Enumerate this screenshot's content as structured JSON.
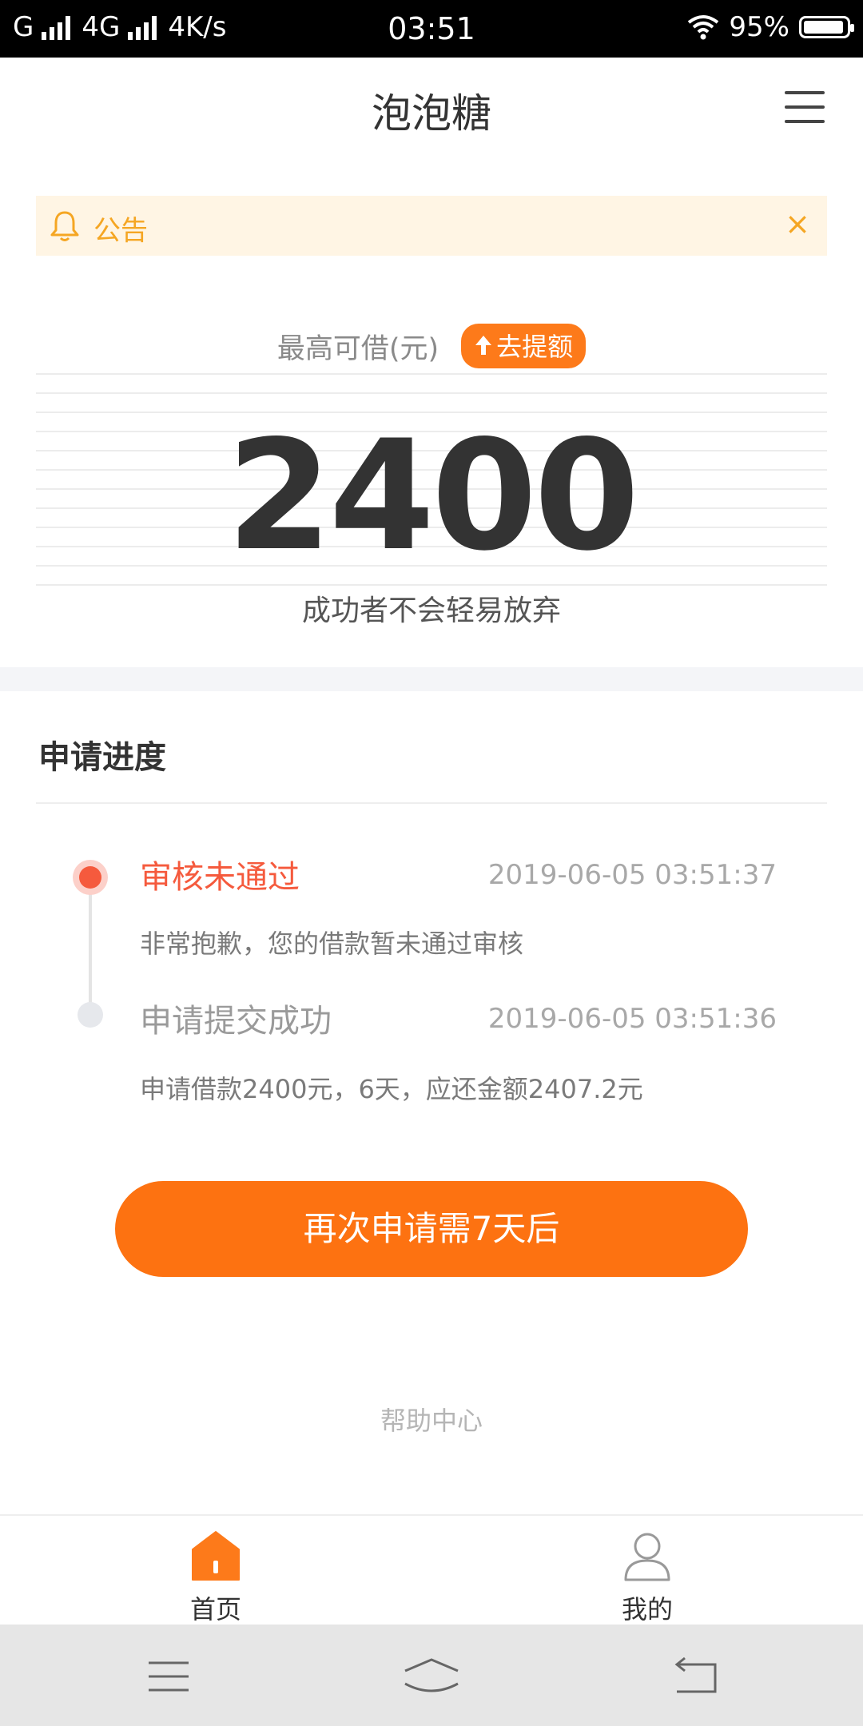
{
  "status_bar": {
    "carrier": "G",
    "network": "4G",
    "speed": "4K/s",
    "time": "03:51",
    "battery": "95%",
    "battery_level": 0.95
  },
  "header": {
    "title": "泡泡糖"
  },
  "notice": {
    "label": "公告",
    "close": "×"
  },
  "credit": {
    "label": "最高可借(元)",
    "raise_button": "去提额",
    "amount": "2400",
    "slogan": "成功者不会轻易放弃"
  },
  "progress": {
    "title": "申请进度",
    "steps": [
      {
        "title": "审核未通过",
        "time": "2019-06-05 03:51:37",
        "desc": "非常抱歉，您的借款暂未通过审核",
        "color": "#f55a3d"
      },
      {
        "title": "申请提交成功",
        "time": "2019-06-05 03:51:36",
        "desc": "申请借款2400元，6天，应还金额2407.2元",
        "color": "#9a9a9a"
      }
    ]
  },
  "cta": {
    "label": "再次申请需7天后",
    "color": "#fd7211"
  },
  "help": {
    "label": "帮助中心"
  },
  "tabbar": {
    "items": [
      {
        "label": "首页",
        "icon": "home-icon",
        "active": true
      },
      {
        "label": "我的",
        "icon": "user-icon",
        "active": false
      }
    ]
  },
  "colors": {
    "accent": "#fd7a1a",
    "notice_bg": "#fff5e4",
    "notice_text": "#f5a623",
    "error": "#f55a3d"
  }
}
